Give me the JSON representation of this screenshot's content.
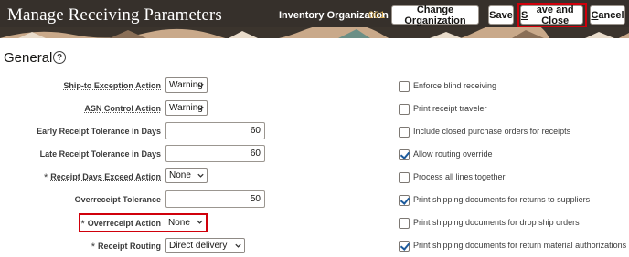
{
  "header": {
    "title": "Manage Receiving Parameters",
    "org_label": "Inventory Organization",
    "org_value": "001",
    "buttons": {
      "change_org": "Change Organization",
      "save": "Save",
      "save_and_close_prefix": "S",
      "save_and_close_rest": "ave and Close",
      "cancel_prefix": "C",
      "cancel_rest": "ancel"
    }
  },
  "section": {
    "title": "General",
    "help_icon": "?"
  },
  "fields": {
    "ship_to_exception": {
      "label": "Ship-to Exception Action",
      "value": "Warning"
    },
    "asn_control": {
      "label": "ASN Control Action",
      "value": "Warning"
    },
    "early_receipt": {
      "label": "Early Receipt Tolerance in Days",
      "value": "60"
    },
    "late_receipt": {
      "label": "Late Receipt Tolerance in Days",
      "value": "60"
    },
    "receipt_days_exceed": {
      "label": "Receipt Days Exceed Action",
      "value": "None",
      "required_marker": "*"
    },
    "overreceipt_tolerance": {
      "label": "Overreceipt Tolerance",
      "value": "50"
    },
    "overreceipt_action": {
      "label": "Overreceipt Action",
      "value": "None",
      "required_marker": "*"
    },
    "receipt_routing": {
      "label": "Receipt Routing",
      "value": "Direct delivery",
      "required_marker": "*"
    }
  },
  "checkboxes": [
    {
      "label": "Enforce blind receiving",
      "checked": false
    },
    {
      "label": "Print receipt traveler",
      "checked": false
    },
    {
      "label": "Include closed purchase orders for receipts",
      "checked": false
    },
    {
      "label": "Allow routing override",
      "checked": true
    },
    {
      "label": "Process all lines together",
      "checked": false
    },
    {
      "label": "Print shipping documents for returns to suppliers",
      "checked": true
    },
    {
      "label": "Print shipping documents for drop ship orders",
      "checked": false
    },
    {
      "label": "Print shipping documents for return material authorizations",
      "checked": true
    }
  ],
  "colors": {
    "header_bg": "#36302b",
    "highlight": "#d0000b",
    "checkmark": "#1c5a9c",
    "org_value": "#e1b55a"
  }
}
